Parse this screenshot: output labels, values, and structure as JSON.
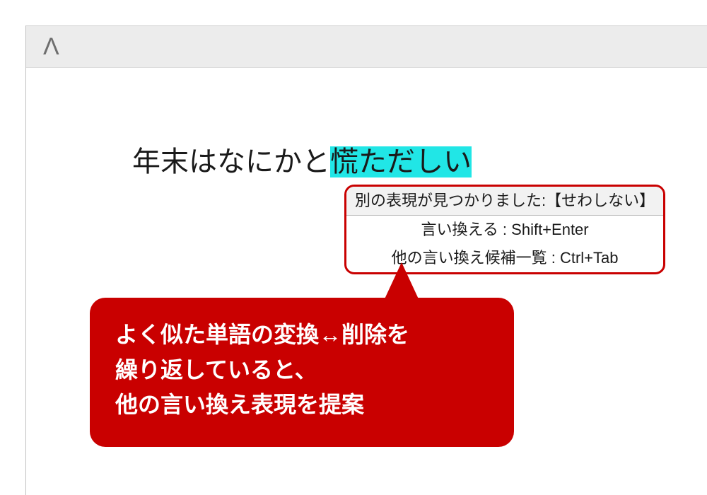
{
  "toolbar": {
    "logo_glyph": "Λ"
  },
  "editor": {
    "prefix": "年末はなにかと",
    "highlight": "慌ただしい"
  },
  "tooltip": {
    "found": "別の表現が見つかりました:【せわしない】",
    "replace": "言い換える : Shift+Enter",
    "list": "他の言い換え候補一覧 : Ctrl+Tab"
  },
  "callout": {
    "line1": "よく似た単語の変換↔削除を",
    "line2": "繰り返していると、",
    "line3": "他の言い換え表現を提案"
  }
}
